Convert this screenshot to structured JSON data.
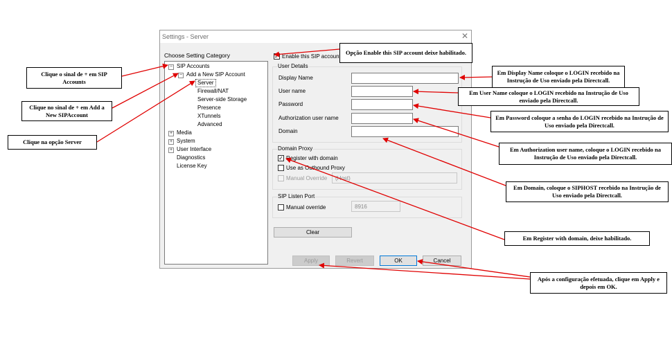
{
  "window": {
    "title": "Settings - Server",
    "close_glyph": "✕"
  },
  "category_label": "Choose Setting Category",
  "tree": {
    "sip_accounts": "SIP Accounts",
    "add_account": "Add a New SIP Account",
    "server": "Server",
    "firewall": "Firewall/NAT",
    "storage": "Server-side Storage",
    "presence": "Presence",
    "xtunnels": "XTunnels",
    "advanced": "Advanced",
    "media": "Media",
    "system": "System",
    "ui": "User Interface",
    "diagnostics": "Diagnostics",
    "license": "License Key"
  },
  "enable_label": "Enable this SIP account",
  "user_details": {
    "title": "User Details",
    "display_name": "Display Name",
    "user_name": "User name",
    "password": "Password",
    "auth_user": "Authorization user name",
    "domain": "Domain"
  },
  "domain_proxy": {
    "title": "Domain Proxy",
    "register": "Register with domain",
    "outbound": "Use as Outbound Proxy",
    "manual": "Manual Override",
    "host_placeholder": "(Host)"
  },
  "listen_port": {
    "title": "SIP Listen Port",
    "manual": "Manual override",
    "port": "8916"
  },
  "buttons": {
    "clear": "Clear",
    "apply": "Apply",
    "revert": "Revert",
    "ok": "OK",
    "cancel": "Cancel"
  },
  "callouts": {
    "c1": "Clique o sinal de + em SIP Accounts",
    "c2": "Clique no sinal de + em Add a New SIPAccount",
    "c3": "Clique na opção Server",
    "c4": "Opção Enable this SIP account deixe habilitado.",
    "c5": "Em Display Name coloque o LOGIN recebido na Instrução de Uso enviado pela Directcall.",
    "c6": "Em User Name coloque o LOGIN recebido na Instrução de Uso enviado pela Directcall.",
    "c7": "Em Password coloque a senha do LOGIN recebido na Instrução de Uso enviado pela Directcall.",
    "c8": "Em Authorization user name, coloque o LOGIN recebido na Instrução de Uso enviado pela Directcall.",
    "c9": "Em Domain, coloque o SIPHOST recebido na Instrução de Uso enviado pela Directcall.",
    "c10": "Em Register with domain, deixe habilitado.",
    "c11": "Após a configuração efetuada, clique em Apply e depois em OK."
  },
  "colors": {
    "arrow": "#e00000",
    "accent": "#0078d7"
  }
}
